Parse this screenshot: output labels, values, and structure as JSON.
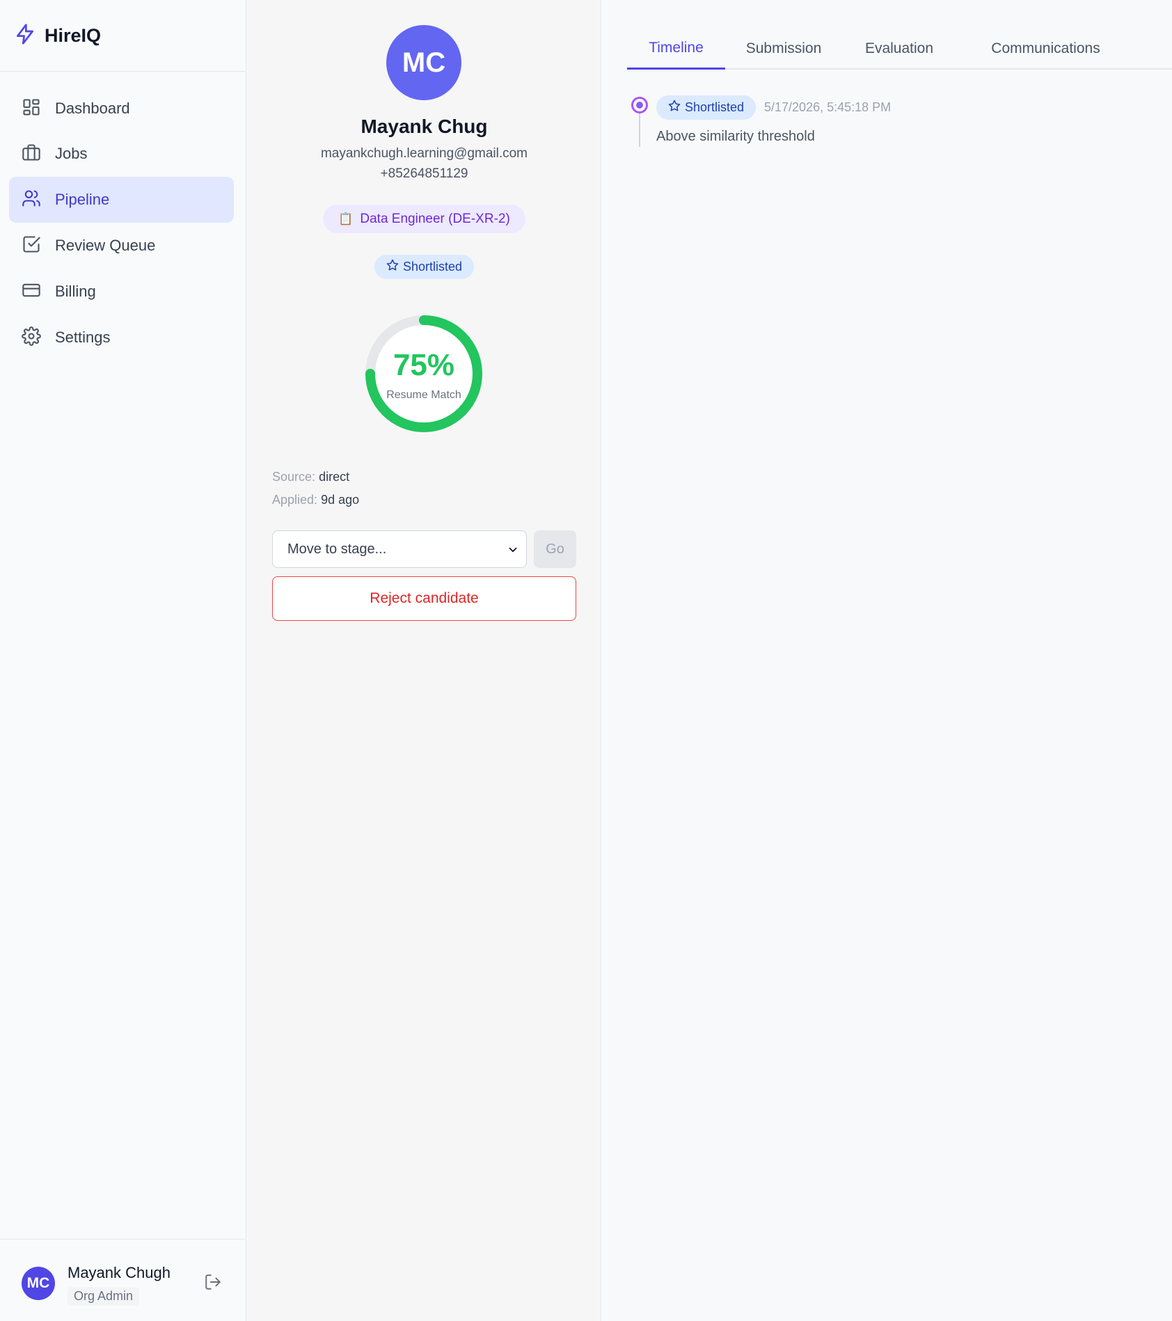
{
  "app": {
    "name": "HireIQ"
  },
  "sidebar": {
    "items": [
      {
        "label": "Dashboard",
        "icon": "dashboard-icon"
      },
      {
        "label": "Jobs",
        "icon": "briefcase-icon"
      },
      {
        "label": "Pipeline",
        "icon": "users-icon",
        "active": true
      },
      {
        "label": "Review Queue",
        "icon": "check-square-icon"
      },
      {
        "label": "Billing",
        "icon": "credit-card-icon"
      },
      {
        "label": "Settings",
        "icon": "gear-icon"
      }
    ]
  },
  "user": {
    "initials": "MC",
    "name": "Mayank Chugh",
    "role": "Org Admin"
  },
  "candidate": {
    "initials": "MC",
    "name": "Mayank Chug",
    "email": "mayankchugh.learning@gmail.com",
    "phone": "+85264851129",
    "job": "Data Engineer (DE-XR-2)",
    "job_icon": "📋",
    "stage": "Shortlisted",
    "match": {
      "value": 75,
      "label": "75%",
      "caption": "Resume Match"
    },
    "source_label": "Source:",
    "source": "direct",
    "applied_label": "Applied:",
    "applied": "9d ago"
  },
  "actions": {
    "stage_select_placeholder": "Move to stage...",
    "go_label": "Go",
    "reject_label": "Reject candidate"
  },
  "tabs": [
    {
      "label": "Timeline",
      "active": true
    },
    {
      "label": "Submission"
    },
    {
      "label": "Evaluation"
    },
    {
      "label": "Communications"
    }
  ],
  "timeline": [
    {
      "stage": "Shortlisted",
      "time": "5/17/2026, 5:45:18 PM",
      "note": "Above similarity threshold"
    }
  ],
  "colors": {
    "accent": "#4f46e5",
    "match_ring": "#22c55e",
    "reject": "#dc2626"
  }
}
